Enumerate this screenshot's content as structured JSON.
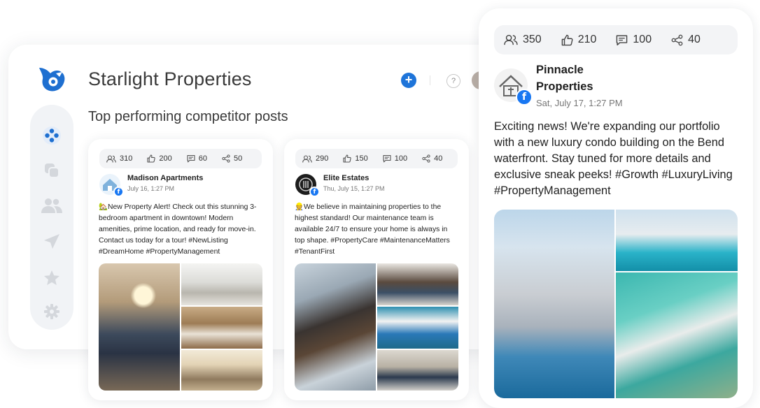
{
  "app": {
    "title": "Starlight Properties",
    "help_label": "?",
    "add_label": "+"
  },
  "section": {
    "title": "Top performing competitor posts"
  },
  "sidebar": {
    "items": [
      {
        "name": "dashboard",
        "icon": "network-icon",
        "active": true
      },
      {
        "name": "posts",
        "icon": "copy-icon",
        "active": false
      },
      {
        "name": "audience",
        "icon": "users-icon",
        "active": false
      },
      {
        "name": "publish",
        "icon": "send-icon",
        "active": false
      },
      {
        "name": "favorites",
        "icon": "star-icon",
        "active": false
      },
      {
        "name": "settings",
        "icon": "gear-icon",
        "active": false
      }
    ]
  },
  "posts": [
    {
      "stats": {
        "reach": "310",
        "likes": "200",
        "comments": "60",
        "shares": "50"
      },
      "author": "Madison Apartments",
      "date": "July 16, 1:27 PM",
      "text": "🏡New Property Alert! Check out this stunning 3-bedroom apartment in downtown! Modern amenities, prime location, and ready for move-in. Contact us today for a tour! #NewListing #DreamHome #PropertyManagement"
    },
    {
      "stats": {
        "reach": "290",
        "likes": "150",
        "comments": "100",
        "shares": "40"
      },
      "author": "Elite Estates",
      "date": "Thu, July 15, 1:27 PM",
      "text": "👷We believe in maintaining properties to the highest standard! Our maintenance team is available 24/7 to ensure your home is always in top shape. #PropertyCare #MaintenanceMatters #TenantFirst"
    },
    {
      "stats": {
        "reach": "350",
        "likes": "210",
        "comments": "100",
        "shares": "40"
      },
      "author": "Pinnacle Properties",
      "date": "Sat, July 17, 1:27 PM",
      "text": "Exciting news! We're expanding our portfolio with a new luxury condo building on the Bend waterfront. Stay tuned for more details and exclusive sneak peeks! #Growth #LuxuryLiving #PropertyManagement"
    }
  ],
  "colors": {
    "accent": "#1e74d9",
    "facebook": "#1877f2",
    "sidebar_bg": "#f1f3f6",
    "icon_muted": "#d4d7dc"
  }
}
